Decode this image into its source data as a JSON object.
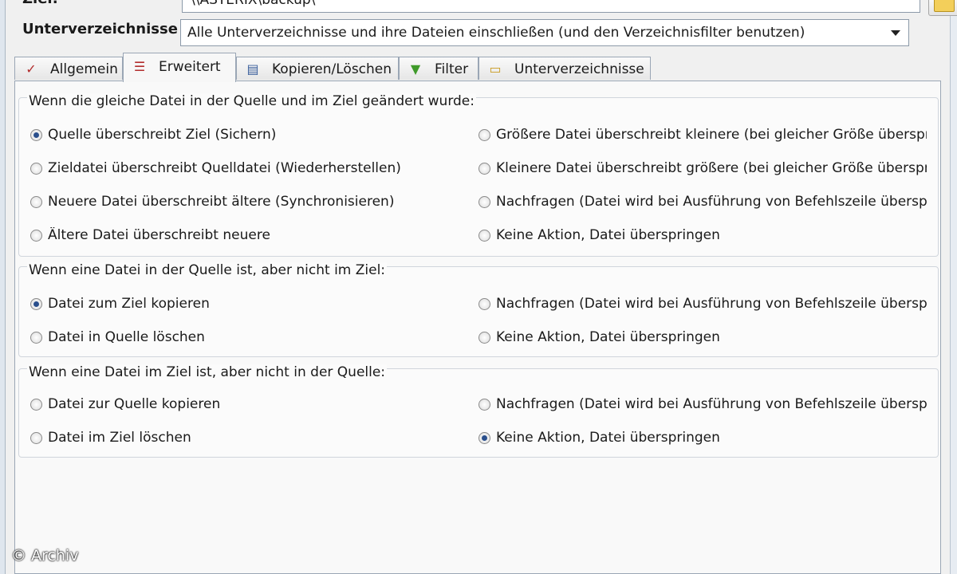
{
  "ziel": {
    "label": "Ziel:",
    "value": "\\\\ASTERIX\\backup\\"
  },
  "unterverzeichnisse": {
    "label": "Unterverzeichnisse",
    "selected": "Alle Unterverzeichnisse und ihre Dateien einschließen  (und den Verzeichnisfilter benutzen)"
  },
  "tabs": [
    {
      "label": "Allgemein",
      "icon": "checklist-icon",
      "active": false
    },
    {
      "label": "Erweitert",
      "icon": "advanced-checklist-icon",
      "active": true
    },
    {
      "label": "Kopieren/Löschen",
      "icon": "copy-delete-icon",
      "active": false
    },
    {
      "label": "Filter",
      "icon": "filter-icon",
      "active": false
    },
    {
      "label": "Unterverzeichnisse",
      "icon": "subfolders-icon",
      "active": false
    }
  ],
  "groups": [
    {
      "title": "Wenn die gleiche Datei in der Quelle und im Ziel geändert wurde:",
      "options_left": [
        {
          "label": "Quelle überschreibt Ziel (Sichern)",
          "checked": true
        },
        {
          "label": "Zieldatei überschreibt Quelldatei (Wiederherstellen)",
          "checked": false
        },
        {
          "label": "Neuere Datei überschreibt ältere (Synchronisieren)",
          "checked": false
        },
        {
          "label": "Ältere Datei überschreibt neuere",
          "checked": false
        }
      ],
      "options_right": [
        {
          "label": "Größere Datei überschreibt kleinere (bei gleicher Größe überspri",
          "checked": false
        },
        {
          "label": "Kleinere Datei überschreibt größere (bei gleicher Größe überspri",
          "checked": false
        },
        {
          "label": "Nachfragen (Datei wird bei Ausführung von Befehlszeile überspr",
          "checked": false
        },
        {
          "label": "Keine Aktion, Datei überspringen",
          "checked": false
        }
      ]
    },
    {
      "title": "Wenn eine Datei in der Quelle ist, aber nicht im Ziel:",
      "options_left": [
        {
          "label": "Datei zum Ziel kopieren",
          "checked": true
        },
        {
          "label": "Datei in Quelle löschen",
          "checked": false
        }
      ],
      "options_right": [
        {
          "label": "Nachfragen (Datei wird bei Ausführung von Befehlszeile überspr",
          "checked": false
        },
        {
          "label": "Keine Aktion, Datei überspringen",
          "checked": false
        }
      ]
    },
    {
      "title": "Wenn eine Datei im Ziel ist, aber nicht in der Quelle:",
      "options_left": [
        {
          "label": "Datei zur Quelle kopieren",
          "checked": false
        },
        {
          "label": "Datei im Ziel löschen",
          "checked": false
        }
      ],
      "options_right": [
        {
          "label": "Nachfragen (Datei wird bei Ausführung von Befehlszeile überspr",
          "checked": false
        },
        {
          "label": "Keine Aktion, Datei überspringen",
          "checked": true
        }
      ]
    }
  ],
  "watermark": "© Archiv",
  "colors": {
    "radio_dot": "#2a4f8c",
    "panel_border": "#9aa6b5",
    "window_bg": "#f0f0f0"
  }
}
